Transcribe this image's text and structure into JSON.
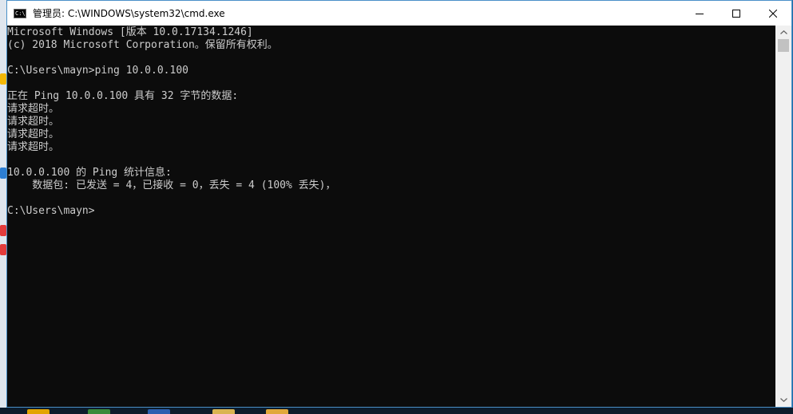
{
  "window": {
    "title": "管理员: C:\\WINDOWS\\system32\\cmd.exe",
    "app_icon_text": "C:\\",
    "controls": {
      "minimize": "minimize-icon",
      "maximize": "maximize-icon",
      "close": "close-icon"
    }
  },
  "console": {
    "lines": [
      "Microsoft Windows [版本 10.0.17134.1246]",
      "(c) 2018 Microsoft Corporation。保留所有权利。",
      "",
      "C:\\Users\\mayn>ping 10.0.0.100",
      "",
      "正在 Ping 10.0.0.100 具有 32 字节的数据:",
      "请求超时。",
      "请求超时。",
      "请求超时。",
      "请求超时。",
      "",
      "10.0.0.100 的 Ping 统计信息:",
      "    数据包: 已发送 = 4，已接收 = 0，丢失 = 4 (100% 丢失)，",
      "",
      "C:\\Users\\mayn>"
    ]
  },
  "colors": {
    "console_bg": "#0c0c0c",
    "console_fg": "#cccccc",
    "titlebar_bg": "#ffffff",
    "window_border": "#4a90c8"
  }
}
